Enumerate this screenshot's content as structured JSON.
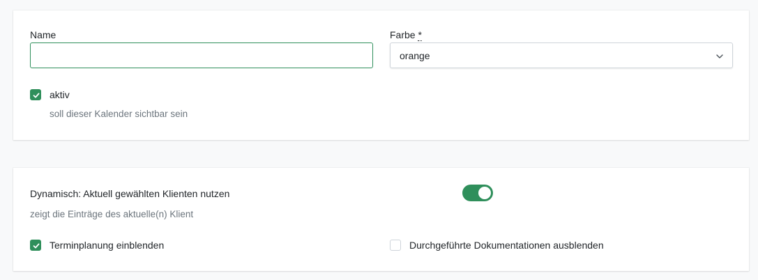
{
  "form": {
    "name_label": "Name",
    "name_value": "",
    "color_label": "Farbe",
    "color_required_mark": "*",
    "color_value": "orange",
    "active_label": "aktiv",
    "active_checked": true,
    "active_help": "soll dieser Kalender sichtbar sein"
  },
  "dynamic": {
    "title": "Dynamisch: Aktuell gewählten Klienten nutzen",
    "help": "zeigt die Einträge des aktuelle(n) Klient",
    "toggle_on": true,
    "show_appointments_label": "Terminplanung einblenden",
    "show_appointments_checked": true,
    "hide_docs_label": "Durchgeführte Dokumentationen ausblenden",
    "hide_docs_checked": false
  },
  "colors": {
    "accent": "#2f8f5b",
    "muted_text": "#6c757d",
    "background": "#f8f9fa"
  }
}
